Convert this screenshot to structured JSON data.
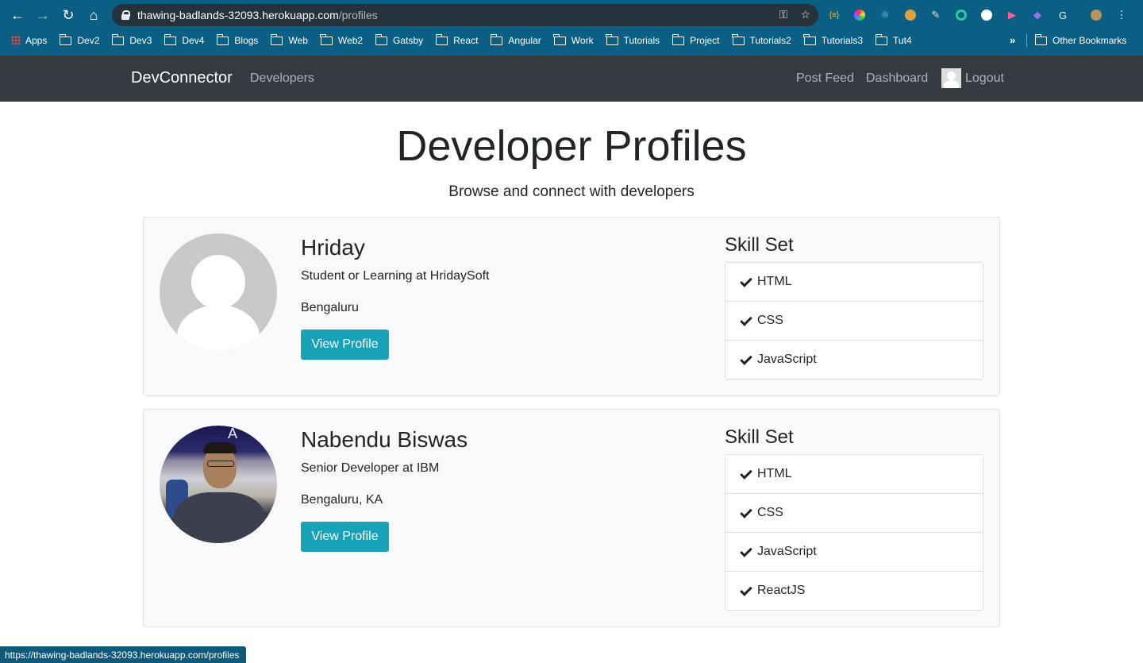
{
  "browser": {
    "url_host": "thawing-badlands-32093.herokuapp.com",
    "url_path": "/profiles",
    "bookmarks": [
      "Apps",
      "Dev2",
      "Dev3",
      "Dev4",
      "Blogs",
      "Web",
      "Web2",
      "Gatsby",
      "React",
      "Angular",
      "Work",
      "Tutorials",
      "Project",
      "Tutorials2",
      "Tutorials3",
      "Tut4"
    ],
    "more": "»",
    "other_bookmarks": "Other Bookmarks",
    "status_url": "https://thawing-badlands-32093.herokuapp.com/profiles"
  },
  "navbar": {
    "brand": "DevConnector",
    "developers": "Developers",
    "post_feed": "Post Feed",
    "dashboard": "Dashboard",
    "logout": "Logout"
  },
  "page": {
    "title": "Developer Profiles",
    "subtitle": "Browse and connect with developers"
  },
  "profiles": [
    {
      "name": "Hriday",
      "status": "Student or Learning at HridaySoft",
      "location": "Bengaluru",
      "button": "View Profile",
      "skill_title": "Skill Set",
      "skills": [
        "HTML",
        "CSS",
        "JavaScript"
      ]
    },
    {
      "name": "Nabendu Biswas",
      "status": "Senior Developer at IBM",
      "location": "Bengaluru, KA",
      "button": "View Profile",
      "skill_title": "Skill Set",
      "skills": [
        "HTML",
        "CSS",
        "JavaScript",
        "ReactJS"
      ],
      "photo_sign": "A"
    }
  ]
}
